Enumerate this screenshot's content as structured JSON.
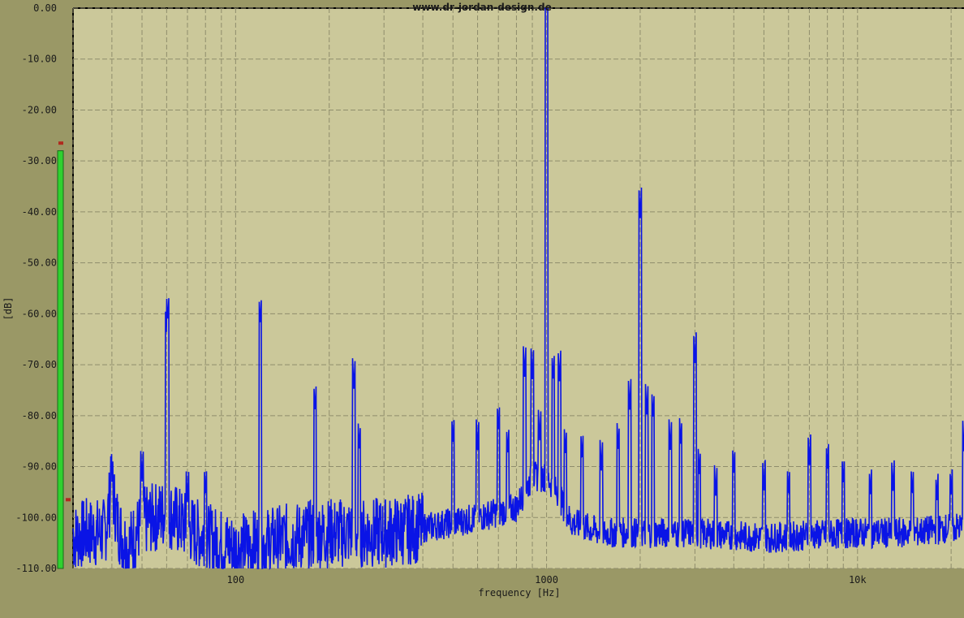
{
  "watermark": "www.dr-jordan-design.de",
  "colors": {
    "background": "#9a9866",
    "plot_area": "#cbc89a",
    "grid": "#8f8d6c",
    "trace": "#0a14e6",
    "meter_fill": "#2fd12f",
    "meter_marker": "#b02a1e"
  },
  "level_meter": {
    "level_db": -28,
    "peak_marker_db": -26.5,
    "low_marker_db": -96.5
  },
  "chart_data": {
    "type": "line",
    "title": "",
    "xlabel": "frequency [Hz]",
    "ylabel": "[dB]",
    "x_scale": "log",
    "xlim": [
      30,
      22000
    ],
    "ylim": [
      -110,
      0
    ],
    "grid": true,
    "y_tick_labels": [
      "0.00",
      "-10.00",
      "-20.00",
      "-30.00",
      "-40.00",
      "-50.00",
      "-60.00",
      "-70.00",
      "-80.00",
      "-90.00",
      "-100.00",
      "-110.00"
    ],
    "y_tick_values": [
      0,
      -10,
      -20,
      -30,
      -40,
      -50,
      -60,
      -70,
      -80,
      -90,
      -100,
      -110
    ],
    "x_tick_labels": [
      "100",
      "1000",
      "10k"
    ],
    "x_tick_values": [
      100,
      1000,
      10000
    ],
    "series": [
      {
        "noise_floor": [
          [
            30,
            -104
          ],
          [
            33,
            -103
          ],
          [
            38,
            -103
          ],
          [
            40,
            -94
          ],
          [
            42,
            -102
          ],
          [
            45,
            -106
          ],
          [
            50,
            -101
          ],
          [
            60,
            -99
          ],
          [
            70,
            -102
          ],
          [
            80,
            -104
          ],
          [
            100,
            -106
          ],
          [
            150,
            -104
          ],
          [
            200,
            -103
          ],
          [
            300,
            -103
          ],
          [
            400,
            -102
          ],
          [
            500,
            -101
          ],
          [
            600,
            -100
          ],
          [
            800,
            -98
          ],
          [
            900,
            -92
          ],
          [
            1000,
            -92
          ],
          [
            1100,
            -96
          ],
          [
            1200,
            -101
          ],
          [
            1500,
            -103
          ],
          [
            2000,
            -103
          ],
          [
            3000,
            -103
          ],
          [
            5000,
            -104
          ],
          [
            10000,
            -103
          ],
          [
            15000,
            -103
          ],
          [
            20000,
            -102
          ],
          [
            22000,
            -102
          ]
        ],
        "peaks": [
          {
            "f": 40,
            "db": -93.5
          },
          {
            "f": 50,
            "db": -93
          },
          {
            "f": 60,
            "db": -96
          },
          {
            "f": 70,
            "db": -97
          },
          {
            "f": 80,
            "db": -96
          },
          {
            "f": 60.5,
            "db": -62
          },
          {
            "f": 60,
            "db": -65
          },
          {
            "f": 120,
            "db": -62.5
          },
          {
            "f": 180,
            "db": -79.5
          },
          {
            "f": 240,
            "db": -75
          },
          {
            "f": 250,
            "db": -87
          },
          {
            "f": 500,
            "db": -86
          },
          {
            "f": 600,
            "db": -87
          },
          {
            "f": 700,
            "db": -83.5
          },
          {
            "f": 750,
            "db": -88
          },
          {
            "f": 850,
            "db": -72.5
          },
          {
            "f": 900,
            "db": -73
          },
          {
            "f": 950,
            "db": -85
          },
          {
            "f": 1000,
            "db": -0.5
          },
          {
            "f": 1050,
            "db": -73.5
          },
          {
            "f": 1100,
            "db": -73.5
          },
          {
            "f": 1150,
            "db": -88
          },
          {
            "f": 1300,
            "db": -89
          },
          {
            "f": 1500,
            "db": -91
          },
          {
            "f": 1700,
            "db": -87
          },
          {
            "f": 1850,
            "db": -79
          },
          {
            "f": 2000,
            "db": -41.5
          },
          {
            "f": 2100,
            "db": -80
          },
          {
            "f": 2200,
            "db": -81
          },
          {
            "f": 2500,
            "db": -87
          },
          {
            "f": 2700,
            "db": -86
          },
          {
            "f": 3000,
            "db": -70
          },
          {
            "f": 3100,
            "db": -92
          },
          {
            "f": 3500,
            "db": -96
          },
          {
            "f": 4000,
            "db": -92
          },
          {
            "f": 5000,
            "db": -95
          },
          {
            "f": 6000,
            "db": -96
          },
          {
            "f": 7000,
            "db": -90
          },
          {
            "f": 8000,
            "db": -91
          },
          {
            "f": 9000,
            "db": -94
          },
          {
            "f": 11000,
            "db": -96
          },
          {
            "f": 13000,
            "db": -95
          },
          {
            "f": 15000,
            "db": -96
          },
          {
            "f": 18000,
            "db": -97
          },
          {
            "f": 20000,
            "db": -96
          },
          {
            "f": 22000,
            "db": -87
          }
        ]
      }
    ]
  }
}
